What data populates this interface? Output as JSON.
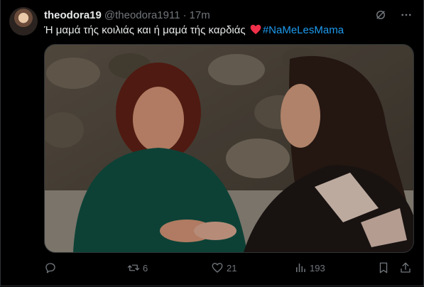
{
  "tweet": {
    "display_name": "theodora19",
    "handle": "@theodora1911",
    "separator": "·",
    "time": "17m",
    "text_before": "Ή μαμά τής κοιλιάς και ή μαμά τής καρδιάς",
    "emoji": "red-heart",
    "hashtag": "#NaMeLesMama"
  },
  "actions": {
    "reply_count": "",
    "retweet_count": "6",
    "like_count": "21",
    "views_count": "193"
  },
  "colors": {
    "background": "#000000",
    "text": "#e7e9ea",
    "muted": "#71767b",
    "link": "#1d9bf0",
    "heart": "#f0304a"
  },
  "icons": [
    "grok-icon",
    "more-icon",
    "reply-icon",
    "retweet-icon",
    "like-icon",
    "views-icon",
    "bookmark-icon",
    "share-icon"
  ]
}
